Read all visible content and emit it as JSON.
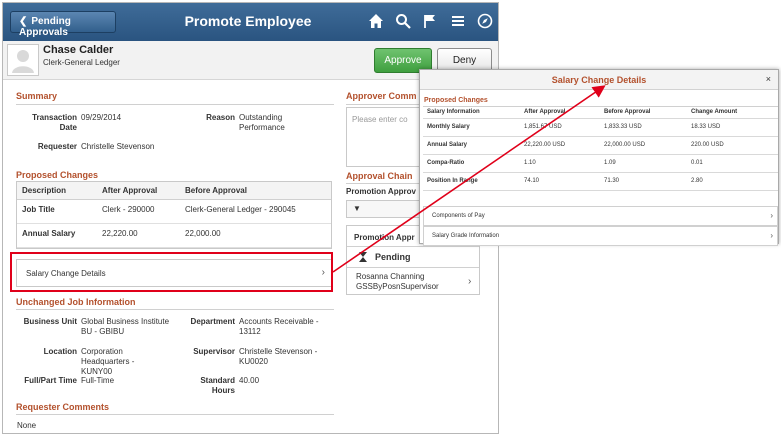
{
  "topbar": {
    "back_label": "Pending Approvals",
    "title": "Promote Employee"
  },
  "icons": [
    "home-icon",
    "search-icon",
    "flag-icon",
    "menu-icon",
    "compass-icon"
  ],
  "employee": {
    "name": "Chase Calder",
    "job": "Clerk-General Ledger"
  },
  "actions": {
    "approve": "Approve",
    "deny": "Deny"
  },
  "summary": {
    "title": "Summary",
    "transaction_date_label": "Transaction Date",
    "transaction_date": "09/29/2014",
    "reason_label": "Reason",
    "reason": "Outstanding Performance",
    "requester_label": "Requester",
    "requester": "Christelle Stevenson"
  },
  "proposed": {
    "title": "Proposed Changes",
    "columns": [
      "Description",
      "After Approval",
      "Before Approval"
    ],
    "rows": [
      [
        "Job Title",
        "Clerk - 290000",
        "Clerk-General Ledger - 290045"
      ],
      [
        "Annual Salary",
        "22,220.00",
        "22,000.00"
      ]
    ],
    "link": "Salary Change Details"
  },
  "unchanged": {
    "title": "Unchanged Job Information",
    "business_unit_label": "Business Unit",
    "business_unit": "Global Business Institute BU - GBIBU",
    "department_label": "Department",
    "department": "Accounts Receivable - 13112",
    "location_label": "Location",
    "location": "Corporation Headquarters - KUNY00",
    "supervisor_label": "Supervisor",
    "supervisor": "Christelle Stevenson - KU0020",
    "fullpart_label": "Full/Part Time",
    "fullpart": "Full-Time",
    "std_hours_label": "Standard Hours",
    "std_hours": "40.00"
  },
  "requester_comments": {
    "title": "Requester Comments",
    "value": "None"
  },
  "approver": {
    "title": "Approver Comm",
    "placeholder": "Please enter co",
    "chain_title": "Approval Chain",
    "chain_sub": "Promotion Approv",
    "chain_box_title": "Promotion Appr",
    "status": "Pending",
    "approver_name": "Rosanna Channing",
    "approver_role": "GSSByPosnSupervisor"
  },
  "popup": {
    "title": "Salary Change Details",
    "close": "×",
    "section": "Proposed Changes",
    "columns": [
      "Salary Information",
      "After Approval",
      "Before Approval",
      "Change Amount"
    ],
    "rows": [
      [
        "Monthly Salary",
        "1,851.67 USD",
        "1,833.33 USD",
        "18.33 USD"
      ],
      [
        "Annual Salary",
        "22,220.00 USD",
        "22,000.00 USD",
        "220.00 USD"
      ],
      [
        "Compa-Ratio",
        "1.10",
        "1.09",
        "0.01"
      ],
      [
        "Position In Range",
        "74.10",
        "71.30",
        "2.80"
      ]
    ],
    "links": [
      "Components of Pay",
      "Salary Grade Information"
    ]
  },
  "colors": {
    "topbar": "#2f5a86",
    "section_title": "#b3512d",
    "approve": "#4caf50",
    "highlight": "#e0001a"
  }
}
